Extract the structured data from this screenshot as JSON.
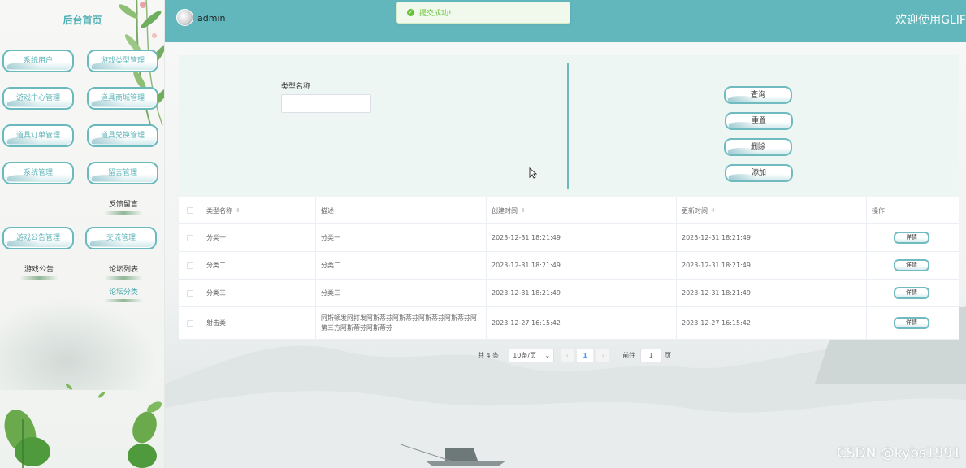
{
  "sidebar": {
    "title": "后台首页",
    "menu": [
      {
        "label": "系统用户"
      },
      {
        "label": "游戏类型管理"
      },
      {
        "label": "游戏中心管理"
      },
      {
        "label": "道具商城管理"
      },
      {
        "label": "道具订单管理"
      },
      {
        "label": "道具兑换管理"
      },
      {
        "label": "系统管理"
      },
      {
        "label": "留言管理"
      },
      {
        "label": "游戏公告管理"
      },
      {
        "label": "交流管理"
      }
    ],
    "subitems": {
      "feedback": "反馈留言",
      "game_notice": "游戏公告",
      "forum_list": "论坛列表",
      "forum_category": "论坛分类"
    }
  },
  "header": {
    "username": "admin",
    "welcome": "欢迎使用GLIF"
  },
  "toast": {
    "message": "提交成功!"
  },
  "search": {
    "label": "类型名称",
    "value": "",
    "placeholder": ""
  },
  "actions": {
    "query": "查询",
    "reset": "重置",
    "delete": "删除",
    "add": "添加"
  },
  "table": {
    "headers": [
      "类型名称",
      "描述",
      "创建时间",
      "更新时间",
      "操作"
    ],
    "rows": [
      {
        "name": "分类一",
        "desc": "分类一",
        "created": "2023-12-31 18:21:49",
        "updated": "2023-12-31 18:21:49",
        "action": "详情"
      },
      {
        "name": "分类二",
        "desc": "分类二",
        "created": "2023-12-31 18:21:49",
        "updated": "2023-12-31 18:21:49",
        "action": "详情"
      },
      {
        "name": "分类三",
        "desc": "分类三",
        "created": "2023-12-31 18:21:49",
        "updated": "2023-12-31 18:21:49",
        "action": "详情"
      },
      {
        "name": "射击类",
        "desc": "阿斯顿发阿打发阿斯蒂芬阿斯蒂芬阿斯蒂芬阿斯蒂芬阿第三方阿斯蒂芬阿斯蒂芬",
        "created": "2023-12-27 16:15:42",
        "updated": "2023-12-27 16:15:42",
        "action": "详情"
      }
    ]
  },
  "pagination": {
    "total": "共 4 条",
    "page_size": "10条/页",
    "prev": "‹",
    "current": "1",
    "next": "›",
    "goto": "前往",
    "goto_value": "1",
    "page_unit": "页"
  },
  "watermark": "CSDN @kybs1991"
}
